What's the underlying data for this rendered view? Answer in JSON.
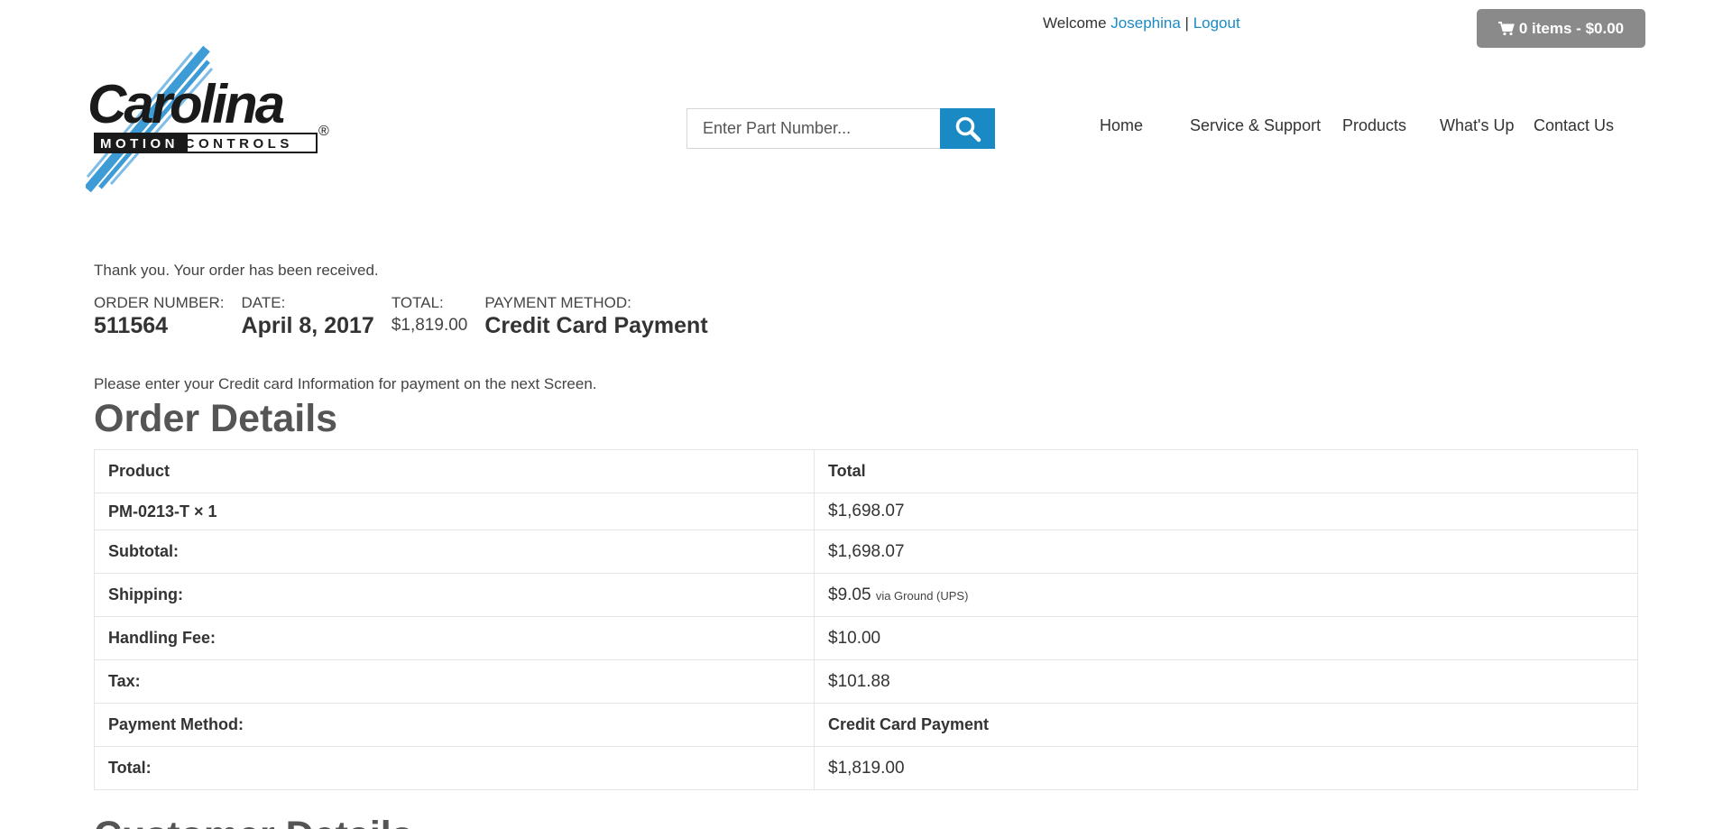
{
  "header": {
    "welcome_text": "Welcome",
    "user_name": "Josephina",
    "separator": "|",
    "logout_label": "Logout",
    "cart_label": "0 items - $0.00",
    "logo_word": "Carolina",
    "logo_sub": "MOTION CONTROLS",
    "logo_reg": "®"
  },
  "search": {
    "placeholder": "Enter Part Number..."
  },
  "nav": {
    "items": [
      "Home",
      "Service & Support",
      "Products",
      "What's Up",
      "Contact Us"
    ]
  },
  "order": {
    "thanks": "Thank you. Your order has been received.",
    "number_label": "ORDER NUMBER:",
    "number": "511564",
    "date_label": "DATE:",
    "date": "April 8, 2017",
    "total_label": "TOTAL:",
    "total": "$1,819.00",
    "payment_label": "PAYMENT METHOD:",
    "payment": "Credit Card Payment",
    "note": "Please enter your Credit card Information for payment on the next Screen.",
    "details_title": "Order Details"
  },
  "table": {
    "headers": [
      "Product",
      "Total"
    ],
    "product": {
      "name": "PM-0213-T",
      "qty": "× 1",
      "total": "$1,698.07"
    },
    "rows": [
      {
        "label": "Subtotal:",
        "value": "$1,698.07"
      },
      {
        "label": "Shipping:",
        "value": "$9.05",
        "extra": "via Ground (UPS)"
      },
      {
        "label": "Handling Fee:",
        "value": "$10.00"
      },
      {
        "label": "Tax:",
        "value": "$101.88"
      },
      {
        "label": "Payment Method:",
        "value": "Credit Card Payment"
      },
      {
        "label": "Total:",
        "value": "$1,819.00"
      }
    ]
  },
  "customer": {
    "title": "Customer Details"
  },
  "colors": {
    "accent": "#1a8ac4",
    "cart_bg": "#8a8a8a"
  }
}
